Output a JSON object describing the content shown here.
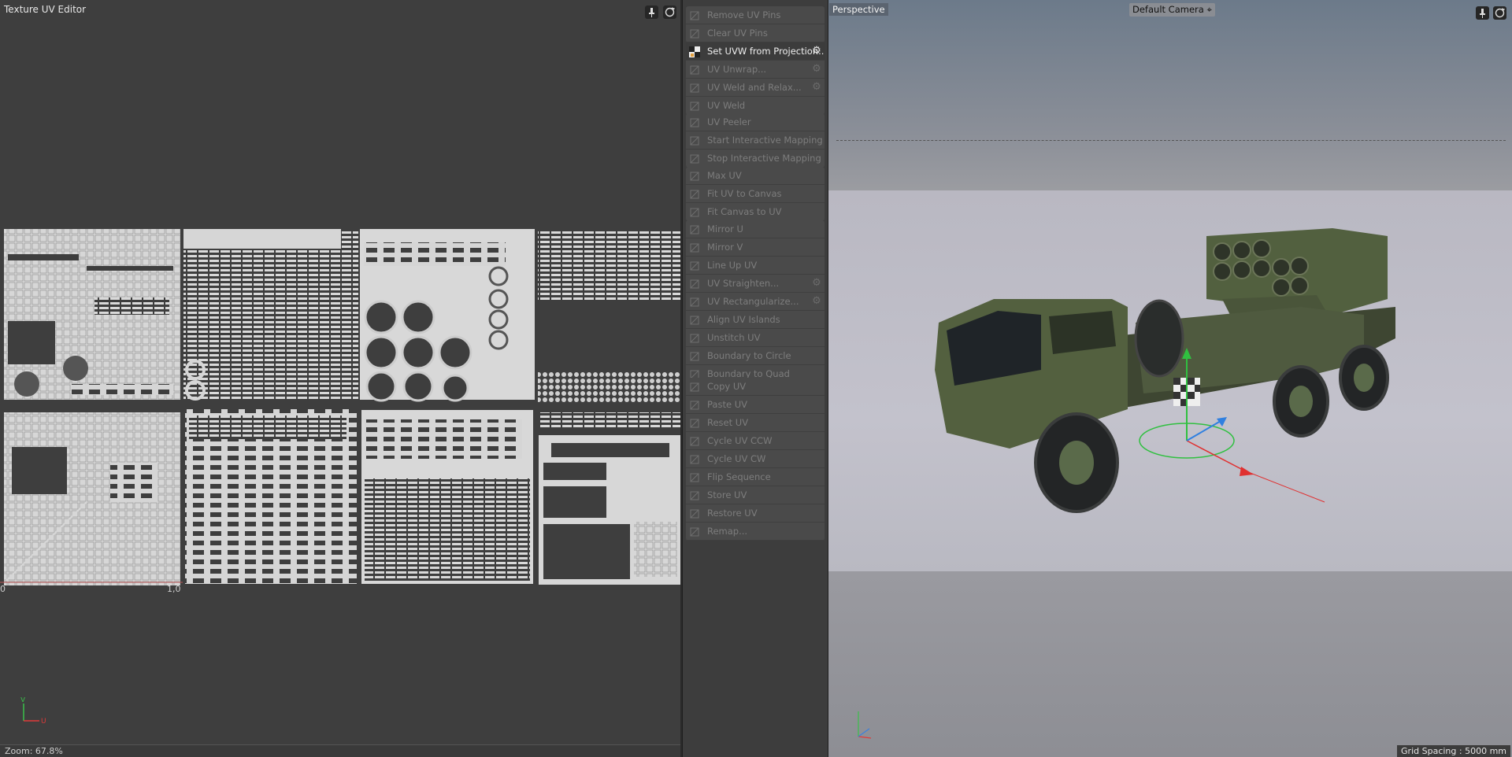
{
  "uv_editor": {
    "title": "Texture UV Editor",
    "zoom": "Zoom: 67.8%",
    "origin_label": "0",
    "one_label": "1,0",
    "axis_u": "U",
    "axis_v": "V",
    "icons": [
      "pin-icon",
      "sync-icon"
    ]
  },
  "commands": {
    "group1": [
      {
        "label": "Remove UV Pins",
        "icon": "remove-pin-icon"
      },
      {
        "label": "Clear UV Pins",
        "icon": "clear-pin-icon"
      }
    ],
    "group2": [
      {
        "label": "Set UVW from Projection...",
        "icon": "checker-icon",
        "active": true,
        "gear": true
      },
      {
        "label": "UV Unwrap...",
        "icon": "unwrap-icon",
        "gear": true
      },
      {
        "label": "UV Weld and Relax...",
        "icon": "weld-relax-icon",
        "gear": true
      },
      {
        "label": "UV Weld",
        "icon": "weld-icon"
      }
    ],
    "group3": [
      {
        "label": "UV Peeler",
        "icon": "peeler-icon"
      },
      {
        "label": "Start Interactive Mapping",
        "icon": "start-mapping-icon"
      },
      {
        "label": "Stop Interactive Mapping",
        "icon": "stop-mapping-icon"
      }
    ],
    "group4": [
      {
        "label": "Max UV",
        "icon": "max-uv-icon"
      },
      {
        "label": "Fit UV to Canvas",
        "icon": "fit-uv-icon"
      },
      {
        "label": "Fit Canvas to UV",
        "icon": "fit-canvas-icon"
      }
    ],
    "group5": [
      {
        "label": "Mirror U",
        "icon": "mirror-u-icon"
      },
      {
        "label": "Mirror V",
        "icon": "mirror-v-icon"
      },
      {
        "label": "Line Up UV",
        "icon": "line-up-icon"
      },
      {
        "label": "UV Straighten...",
        "icon": "straighten-icon",
        "gear": true
      },
      {
        "label": "UV Rectangularize...",
        "icon": "rectangularize-icon",
        "gear": true
      },
      {
        "label": "Align UV Islands",
        "icon": "align-islands-icon"
      },
      {
        "label": "Unstitch UV",
        "icon": "unstitch-icon"
      },
      {
        "label": "Boundary to Circle",
        "icon": "boundary-circle-icon"
      },
      {
        "label": "Boundary to Quad",
        "icon": "boundary-quad-icon"
      }
    ],
    "group6": [
      {
        "label": "Copy UV",
        "icon": "copy-uv-icon"
      },
      {
        "label": "Paste UV",
        "icon": "paste-uv-icon"
      },
      {
        "label": "Reset UV",
        "icon": "reset-uv-icon"
      },
      {
        "label": "Cycle UV CCW",
        "icon": "cycle-ccw-icon"
      },
      {
        "label": "Cycle UV CW",
        "icon": "cycle-cw-icon"
      },
      {
        "label": "Flip Sequence",
        "icon": "flip-sequence-icon"
      },
      {
        "label": "Store UV",
        "icon": "store-uv-icon"
      },
      {
        "label": "Restore UV",
        "icon": "restore-uv-icon"
      },
      {
        "label": "Remap...",
        "icon": "remap-icon"
      }
    ]
  },
  "viewport": {
    "view_name": "Perspective",
    "camera": "Default Camera",
    "grid_spacing": "Grid Spacing : 5000 mm",
    "colors": {
      "truck": "#4f5a3f",
      "x_axis": "#e03030",
      "y_axis": "#30c040",
      "z_axis": "#3080e0"
    }
  }
}
